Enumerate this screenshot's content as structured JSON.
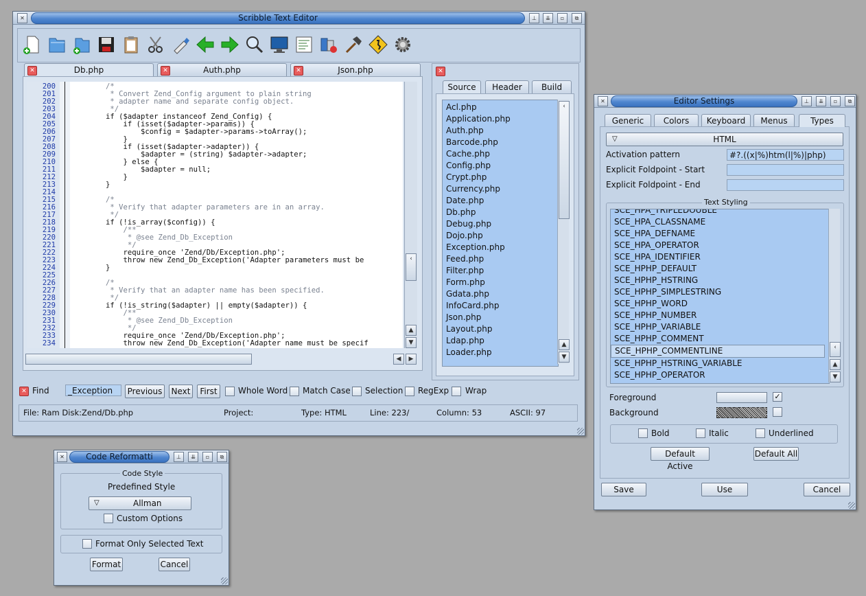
{
  "main_window": {
    "title": "Scribble Text Editor",
    "tabs": [
      {
        "label": "Db.php"
      },
      {
        "label": "Auth.php"
      },
      {
        "label": "Json.php"
      }
    ],
    "code_lines": [
      {
        "n": "200",
        "t": "        /*",
        "k": "c"
      },
      {
        "n": "201",
        "t": "         * Convert Zend_Config argument to plain string",
        "k": "c"
      },
      {
        "n": "202",
        "t": "         * adapter name and separate config object.",
        "k": "c"
      },
      {
        "n": "203",
        "t": "         */",
        "k": "c"
      },
      {
        "n": "204",
        "t": "        if ($adapter instanceof Zend_Config) {",
        "k": "n"
      },
      {
        "n": "205",
        "t": "            if (isset($adapter->params)) {",
        "k": "n"
      },
      {
        "n": "206",
        "t": "                $config = $adapter->params->toArray();",
        "k": "n"
      },
      {
        "n": "207",
        "t": "            }",
        "k": "n"
      },
      {
        "n": "208",
        "t": "            if (isset($adapter->adapter)) {",
        "k": "n"
      },
      {
        "n": "209",
        "t": "                $adapter = (string) $adapter->adapter;",
        "k": "n"
      },
      {
        "n": "210",
        "t": "            } else {",
        "k": "n"
      },
      {
        "n": "211",
        "t": "                $adapter = null;",
        "k": "n"
      },
      {
        "n": "212",
        "t": "            }",
        "k": "n"
      },
      {
        "n": "213",
        "t": "        }",
        "k": "n"
      },
      {
        "n": "214",
        "t": "",
        "k": "n"
      },
      {
        "n": "215",
        "t": "        /*",
        "k": "c"
      },
      {
        "n": "216",
        "t": "         * Verify that adapter parameters are in an array.",
        "k": "c"
      },
      {
        "n": "217",
        "t": "         */",
        "k": "c"
      },
      {
        "n": "218",
        "t": "        if (!is_array($config)) {",
        "k": "n"
      },
      {
        "n": "219",
        "t": "            /**",
        "k": "c"
      },
      {
        "n": "220",
        "t": "             * @see Zend_Db_Exception",
        "k": "c"
      },
      {
        "n": "221",
        "t": "             */",
        "k": "c"
      },
      {
        "n": "222",
        "t": "            require_once 'Zend/Db/Exception.php';",
        "k": "n"
      },
      {
        "n": "223",
        "t": "            throw new Zend_Db_Exception('Adapter parameters must be",
        "k": "n"
      },
      {
        "n": "224",
        "t": "        }",
        "k": "n"
      },
      {
        "n": "225",
        "t": "",
        "k": "n"
      },
      {
        "n": "226",
        "t": "        /*",
        "k": "c"
      },
      {
        "n": "227",
        "t": "         * Verify that an adapter name has been specified.",
        "k": "c"
      },
      {
        "n": "228",
        "t": "         */",
        "k": "c"
      },
      {
        "n": "229",
        "t": "        if (!is_string($adapter) || empty($adapter)) {",
        "k": "n"
      },
      {
        "n": "230",
        "t": "            /**",
        "k": "c"
      },
      {
        "n": "231",
        "t": "             * @see Zend_Db_Exception",
        "k": "c"
      },
      {
        "n": "232",
        "t": "             */",
        "k": "c"
      },
      {
        "n": "233",
        "t": "            require_once 'Zend/Db/Exception.php';",
        "k": "n"
      },
      {
        "n": "234",
        "t": "            throw new Zend_Db_Exception('Adapter name must be specif",
        "k": "n"
      }
    ],
    "side_tabs": [
      {
        "label": "Source"
      },
      {
        "label": "Header"
      },
      {
        "label": "Build"
      }
    ],
    "files": [
      "Acl.php",
      "Application.php",
      "Auth.php",
      "Barcode.php",
      "Cache.php",
      "Config.php",
      "Crypt.php",
      "Currency.php",
      "Date.php",
      "Db.php",
      "Debug.php",
      "Dojo.php",
      "Exception.php",
      "Feed.php",
      "Filter.php",
      "Form.php",
      "Gdata.php",
      "InfoCard.php",
      "Json.php",
      "Layout.php",
      "Ldap.php",
      "Loader.php"
    ],
    "find": {
      "label": "Find",
      "value": "_Exception",
      "previous": "Previous",
      "next": "Next",
      "first": "First",
      "whole_word": "Whole Word",
      "match_case": "Match Case",
      "selection": "Selection",
      "regexp": "RegExp",
      "wrap": "Wrap"
    },
    "status": {
      "file": "File:  Ram Disk:Zend/Db.php",
      "project": "Project:",
      "type": "Type:  HTML",
      "line": "Line:  223/",
      "column": "Column:  53",
      "ascii": "ASCII:  97"
    }
  },
  "reformat_window": {
    "title": "Code Reformatti",
    "group_title": "Code Style",
    "predefined_label": "Predefined Style",
    "style_value": "Allman",
    "custom_options": "Custom Options",
    "format_selected": "Format Only Selected Text",
    "format_btn": "Format",
    "cancel_btn": "Cancel"
  },
  "settings_window": {
    "title": "Editor Settings",
    "tabs": [
      {
        "label": "Generic"
      },
      {
        "label": "Colors"
      },
      {
        "label": "Keyboard"
      },
      {
        "label": "Menus"
      },
      {
        "label": "Types"
      }
    ],
    "type_select": "HTML",
    "activation_label": "Activation pattern",
    "activation_value": "#?.((x|%)htm(l|%)|php)",
    "fold_start_label": "Explicit Foldpoint - Start",
    "fold_end_label": "Explicit Foldpoint - End",
    "styling_title": "Text Styling",
    "styles": [
      "SCE_HPA_TRIPLEDOUBLE",
      "SCE_HPA_CLASSNAME",
      "SCE_HPA_DEFNAME",
      "SCE_HPA_OPERATOR",
      "SCE_HPA_IDENTIFIER",
      "SCE_HPHP_DEFAULT",
      "SCE_HPHP_HSTRING",
      "SCE_HPHP_SIMPLESTRING",
      "SCE_HPHP_WORD",
      "SCE_HPHP_NUMBER",
      "SCE_HPHP_VARIABLE",
      "SCE_HPHP_COMMENT",
      "SCE_HPHP_COMMENTLINE",
      "SCE_HPHP_HSTRING_VARIABLE",
      "SCE_HPHP_OPERATOR"
    ],
    "foreground_label": "Foreground",
    "background_label": "Background",
    "bold": "Bold",
    "italic": "Italic",
    "underlined": "Underlined",
    "default_active": "Default Active",
    "default_all": "Default All",
    "save": "Save",
    "use": "Use",
    "cancel": "Cancel"
  }
}
